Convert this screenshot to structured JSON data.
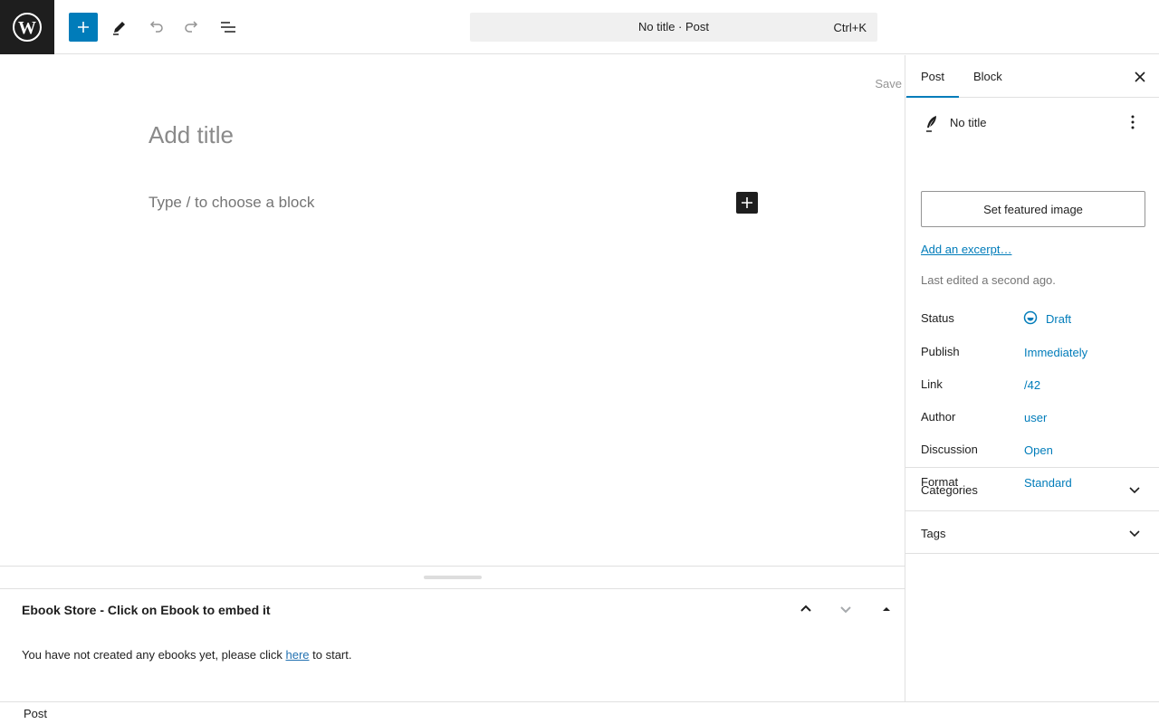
{
  "toolbar": {
    "add_block": "plus-icon",
    "tools": "pencil-icon",
    "undo": "undo-icon",
    "redo": "redo-icon",
    "list_view": "list-view-icon"
  },
  "command_bar": {
    "title": "No title · Post",
    "shortcut": "Ctrl+K"
  },
  "editor": {
    "save_label": "Save",
    "title_placeholder": "Add title",
    "block_placeholder": "Type / to choose a block"
  },
  "metabox": {
    "title": "Ebook Store - Click on Ebook to embed it",
    "text_before": "You have not created any ebooks yet, please click ",
    "link_text": "here",
    "text_after": " to start."
  },
  "sidebar": {
    "tabs": [
      "Post",
      "Block"
    ],
    "post_title": "No title",
    "featured_image_button": "Set featured image",
    "excerpt_link": "Add an excerpt…",
    "last_edited": "Last edited a second ago.",
    "rows": [
      {
        "label": "Status",
        "value": "Draft"
      },
      {
        "label": "Publish",
        "value": "Immediately"
      },
      {
        "label": "Link",
        "value": "/42"
      },
      {
        "label": "Author",
        "value": "user"
      },
      {
        "label": "Discussion",
        "value": "Open"
      },
      {
        "label": "Format",
        "value": "Standard"
      }
    ],
    "panels": [
      "Categories",
      "Tags"
    ]
  },
  "footer": {
    "breadcrumb": "Post"
  },
  "colors": {
    "accent": "#007cba",
    "dark": "#1e1e1e"
  }
}
